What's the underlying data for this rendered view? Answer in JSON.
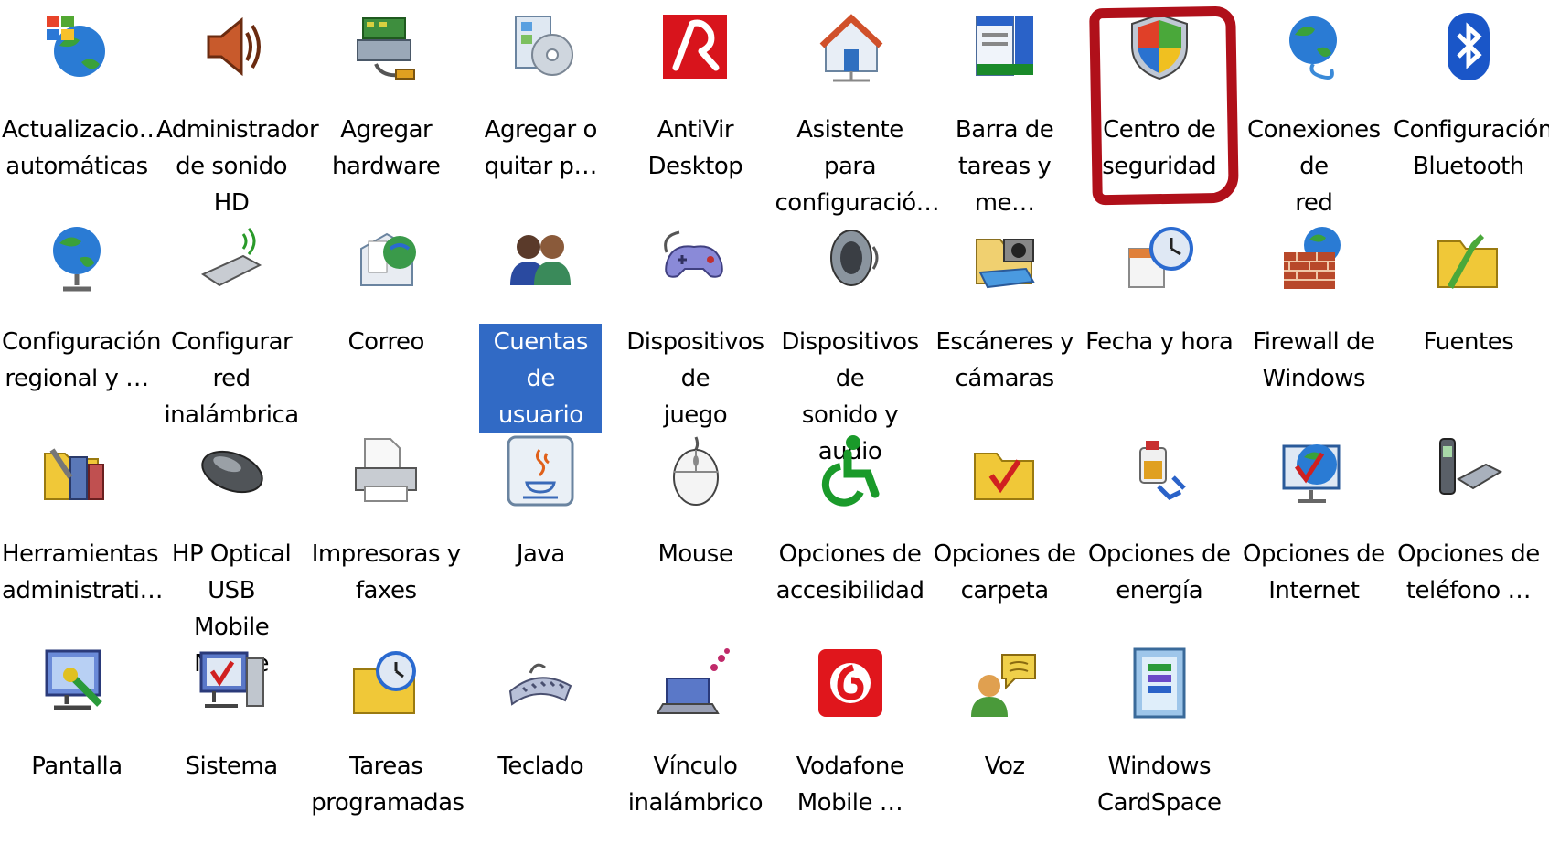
{
  "highlight_color": "#b0101a",
  "selection_color": "#316ac5",
  "items": [
    {
      "label": "Actualizacio…\nautomáticas",
      "icon": "windows-update-icon"
    },
    {
      "label": "Administrador\nde sonido HD",
      "icon": "speaker-icon"
    },
    {
      "label": "Agregar\nhardware",
      "icon": "add-hardware-icon"
    },
    {
      "label": "Agregar o\nquitar p…",
      "icon": "add-remove-programs-icon"
    },
    {
      "label": "AntiVir\nDesktop",
      "icon": "antivir-icon"
    },
    {
      "label": "Asistente para\nconfiguració…",
      "icon": "network-setup-icon"
    },
    {
      "label": "Barra de\ntareas y me…",
      "icon": "taskbar-icon"
    },
    {
      "label": "Centro de\nseguridad",
      "icon": "security-shield-icon"
    },
    {
      "label": "Conexiones de\nred",
      "icon": "network-globe-icon"
    },
    {
      "label": "Configuración\nBluetooth",
      "icon": "bluetooth-icon"
    },
    {
      "label": "Configuración\nregional y …",
      "icon": "globe-icon"
    },
    {
      "label": "Configurar red\ninalámbrica",
      "icon": "wireless-adapter-icon"
    },
    {
      "label": "Correo",
      "icon": "mail-icon"
    },
    {
      "label": "Cuentas de\nusuario",
      "icon": "user-accounts-icon",
      "selected": true
    },
    {
      "label": "Dispositivos de\njuego",
      "icon": "gamepad-icon"
    },
    {
      "label": "Dispositivos de\nsonido y audio",
      "icon": "audio-speaker-icon"
    },
    {
      "label": "Escáneres y\ncámaras",
      "icon": "scanner-camera-icon"
    },
    {
      "label": "Fecha y hora",
      "icon": "date-time-icon"
    },
    {
      "label": "Firewall de\nWindows",
      "icon": "firewall-icon"
    },
    {
      "label": "Fuentes",
      "icon": "fonts-folder-icon"
    },
    {
      "label": "Herramientas\nadministrati…",
      "icon": "admin-tools-icon"
    },
    {
      "label": "HP Optical USB\nMobile Mouse",
      "icon": "hp-mouse-icon"
    },
    {
      "label": "Impresoras y\nfaxes",
      "icon": "printer-icon"
    },
    {
      "label": "Java",
      "icon": "java-icon"
    },
    {
      "label": "Mouse",
      "icon": "mouse-icon"
    },
    {
      "label": "Opciones de\naccesibilidad",
      "icon": "accessibility-icon"
    },
    {
      "label": "Opciones de\ncarpeta",
      "icon": "folder-options-icon"
    },
    {
      "label": "Opciones de\nenergía",
      "icon": "power-options-icon"
    },
    {
      "label": "Opciones de\nInternet",
      "icon": "internet-options-icon"
    },
    {
      "label": "Opciones de\nteléfono …",
      "icon": "phone-modem-icon"
    },
    {
      "label": "Pantalla",
      "icon": "display-icon"
    },
    {
      "label": "Sistema",
      "icon": "system-icon"
    },
    {
      "label": "Tareas\nprogramadas",
      "icon": "scheduled-tasks-icon"
    },
    {
      "label": "Teclado",
      "icon": "keyboard-icon"
    },
    {
      "label": "Vínculo\ninalámbrico",
      "icon": "wireless-link-icon"
    },
    {
      "label": "Vodafone\nMobile …",
      "icon": "vodafone-icon"
    },
    {
      "label": "Voz",
      "icon": "speech-icon"
    },
    {
      "label": "Windows\nCardSpace",
      "icon": "cardspace-icon"
    }
  ]
}
